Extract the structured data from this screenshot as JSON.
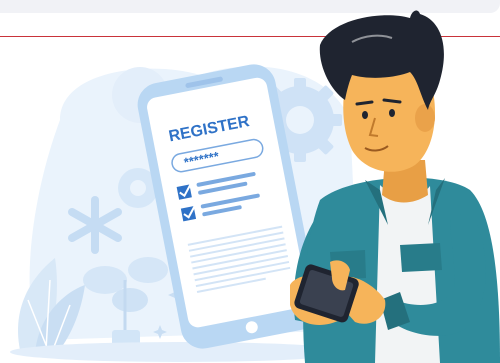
{
  "illustration": {
    "phone_screen": {
      "heading": "REGISTER",
      "password_mask": "*******"
    },
    "colors": {
      "background_blob": "#e9f2fb",
      "phone_body": "#b9d7f3",
      "phone_screen": "#ffffff",
      "accent_blue": "#2f72c7",
      "shirt_teal": "#2f8b9b",
      "skin": "#f6b45a",
      "hair": "#1f2430",
      "top_bar": "#f1f2f6",
      "divider_red": "#c9333a"
    }
  }
}
